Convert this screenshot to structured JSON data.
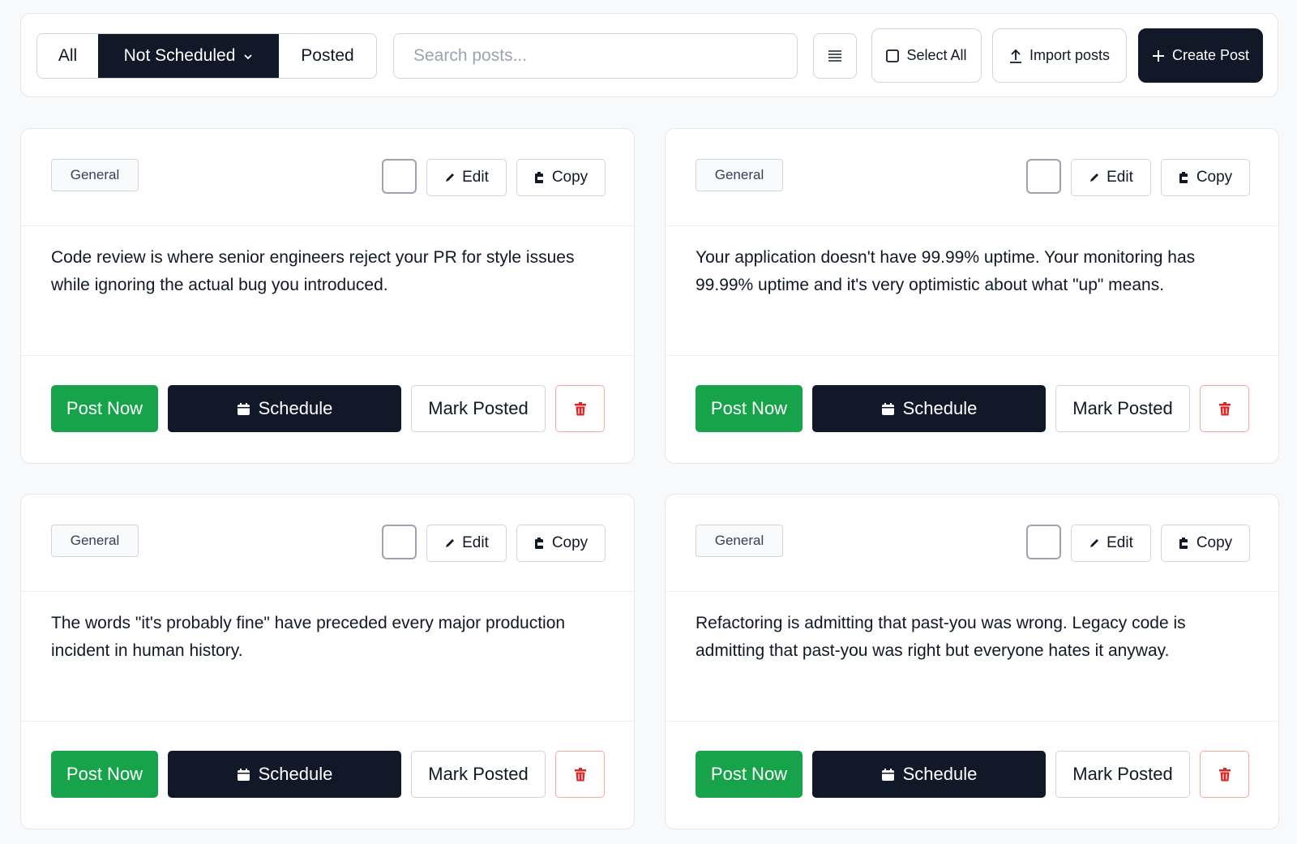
{
  "toolbar": {
    "filters": [
      "All",
      "Not Scheduled",
      "Posted"
    ],
    "active_filter": "Not Scheduled",
    "search_placeholder": "Search posts...",
    "select_all_label": "Select All",
    "import_label": "Import posts",
    "create_label": "Create Post"
  },
  "labels": {
    "edit": "Edit",
    "copy": "Copy",
    "post_now": "Post Now",
    "schedule": "Schedule",
    "mark_posted": "Mark Posted"
  },
  "posts": [
    {
      "category": "General",
      "text": "Code review is where senior engineers reject your PR for style issues while ignoring the actual bug you introduced."
    },
    {
      "category": "General",
      "text": "Your application doesn't have 99.99% uptime. Your monitoring has 99.99% uptime and it's very optimistic about what \"up\" means."
    },
    {
      "category": "General",
      "text": "The words \"it's probably fine\" have preceded every major production incident in human history."
    },
    {
      "category": "General",
      "text": "Refactoring is admitting that past-you was wrong. Legacy code is admitting that past-you was right but everyone hates it anyway."
    }
  ],
  "colors": {
    "primary_dark": "#111827",
    "post_now_green": "#16a34a",
    "delete_red": "#dc2626"
  },
  "icons": [
    "chevron-down-icon",
    "list-icon",
    "checkbox-icon",
    "upload-icon",
    "plus-icon",
    "pencil-icon",
    "clipboard-icon",
    "calendar-icon",
    "trash-icon"
  ]
}
